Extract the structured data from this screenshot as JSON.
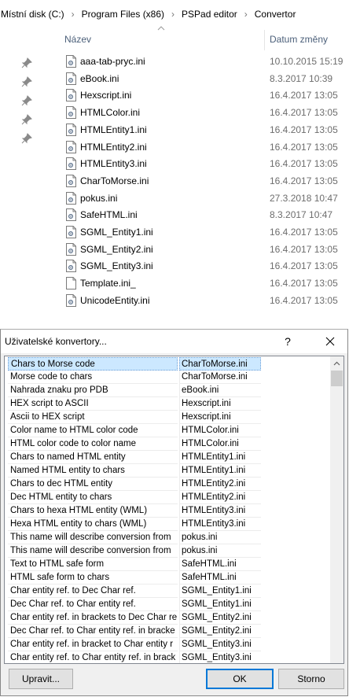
{
  "explorer": {
    "breadcrumb": [
      "Místní disk (C:)",
      "Program Files (x86)",
      "PSPad editor",
      "Convertor"
    ],
    "columns": {
      "name": "Název",
      "date": "Datum změny"
    },
    "files": [
      {
        "name": "aaa-tab-pryc.ini",
        "date": "10.10.2015 15:19",
        "icon": "ini-file-icon"
      },
      {
        "name": "eBook.ini",
        "date": "8.3.2017 10:39",
        "icon": "ini-file-icon"
      },
      {
        "name": "Hexscript.ini",
        "date": "16.4.2017 13:05",
        "icon": "ini-file-icon"
      },
      {
        "name": "HTMLColor.ini",
        "date": "16.4.2017 13:05",
        "icon": "ini-file-icon"
      },
      {
        "name": "HTMLEntity1.ini",
        "date": "16.4.2017 13:05",
        "icon": "ini-file-icon"
      },
      {
        "name": "HTMLEntity2.ini",
        "date": "16.4.2017 13:05",
        "icon": "ini-file-icon"
      },
      {
        "name": "HTMLEntity3.ini",
        "date": "16.4.2017 13:05",
        "icon": "ini-file-icon"
      },
      {
        "name": "CharToMorse.ini",
        "date": "16.4.2017 13:05",
        "icon": "ini-file-icon"
      },
      {
        "name": "pokus.ini",
        "date": "27.3.2018 10:47",
        "icon": "ini-file-icon"
      },
      {
        "name": "SafeHTML.ini",
        "date": "8.3.2017 10:47",
        "icon": "ini-file-icon"
      },
      {
        "name": "SGML_Entity1.ini",
        "date": "16.4.2017 13:05",
        "icon": "ini-file-icon"
      },
      {
        "name": "SGML_Entity2.ini",
        "date": "16.4.2017 13:05",
        "icon": "ini-file-icon"
      },
      {
        "name": "SGML_Entity3.ini",
        "date": "16.4.2017 13:05",
        "icon": "ini-file-icon"
      },
      {
        "name": "Template.ini_",
        "date": "16.4.2017 13:05",
        "icon": "blank-file-icon"
      },
      {
        "name": "UnicodeEntity.ini",
        "date": "16.4.2017 13:05",
        "icon": "ini-file-icon"
      }
    ]
  },
  "dialog": {
    "title": "Uživatelské konvertory...",
    "help_label": "?",
    "rows": [
      {
        "desc": "Chars to Morse code",
        "file": "CharToMorse.ini",
        "selected": true
      },
      {
        "desc": "Morse code to chars",
        "file": "CharToMorse.ini"
      },
      {
        "desc": "Nahrada znaku pro PDB",
        "file": "eBook.ini"
      },
      {
        "desc": "HEX script to ASCII",
        "file": "Hexscript.ini"
      },
      {
        "desc": "Ascii to HEX script",
        "file": "Hexscript.ini"
      },
      {
        "desc": "Color name to HTML color code",
        "file": "HTMLColor.ini"
      },
      {
        "desc": "HTML color code to color name",
        "file": "HTMLColor.ini"
      },
      {
        "desc": "Chars to named HTML entity",
        "file": "HTMLEntity1.ini"
      },
      {
        "desc": "Named HTML entity to chars",
        "file": "HTMLEntity1.ini"
      },
      {
        "desc": "Chars to dec HTML entity",
        "file": "HTMLEntity2.ini"
      },
      {
        "desc": "Dec HTML entity to chars",
        "file": "HTMLEntity2.ini"
      },
      {
        "desc": "Chars to hexa HTML entity (WML)",
        "file": "HTMLEntity3.ini"
      },
      {
        "desc": "Hexa HTML entity to chars (WML)",
        "file": "HTMLEntity3.ini"
      },
      {
        "desc": "This name will describe conversion from",
        "file": "pokus.ini"
      },
      {
        "desc": "This name will describe conversion from",
        "file": "pokus.ini"
      },
      {
        "desc": "Text to HTML safe form",
        "file": "SafeHTML.ini"
      },
      {
        "desc": "HTML safe form to chars",
        "file": "SafeHTML.ini"
      },
      {
        "desc": "Char entity ref. to Dec Char ref.",
        "file": "SGML_Entity1.ini"
      },
      {
        "desc": "Dec Char ref. to Char entity ref.",
        "file": "SGML_Entity1.ini"
      },
      {
        "desc": "Char entity ref. in brackets to Dec Char re",
        "file": "SGML_Entity2.ini"
      },
      {
        "desc": "Dec Char ref. to Char entity ref. in bracke",
        "file": "SGML_Entity2.ini"
      },
      {
        "desc": "Char entity ref. in bracket to Char entity r",
        "file": "SGML_Entity3.ini"
      },
      {
        "desc": "Char entity ref. to Char entity ref. in brack",
        "file": "SGML_Entity3.ini"
      }
    ],
    "buttons": {
      "edit": "Upravit...",
      "ok": "OK",
      "cancel": "Storno"
    }
  },
  "colors": {
    "selection": "#cce8ff",
    "accent": "#0078d7",
    "dialog_bg": "#f0f0f0"
  }
}
